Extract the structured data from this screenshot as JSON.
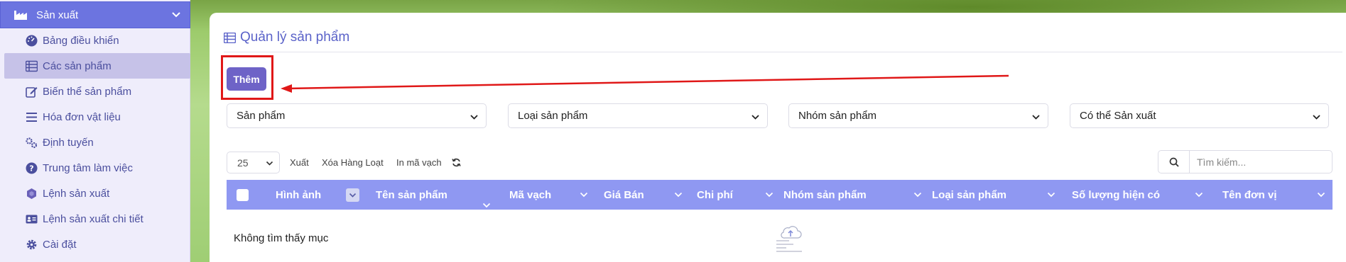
{
  "sidebar": {
    "header_label": "Sản xuất",
    "items": [
      {
        "label": "Bảng điều khiển",
        "icon": "dashboard-icon"
      },
      {
        "label": "Các sản phẩm",
        "icon": "table-list-icon",
        "active": true
      },
      {
        "label": "Biến thể sản phẩm",
        "icon": "edit-square-icon"
      },
      {
        "label": "Hóa đơn vật liệu",
        "icon": "list-lines-icon"
      },
      {
        "label": "Định tuyến",
        "icon": "gears-icon"
      },
      {
        "label": "Trung tâm làm việc",
        "icon": "question-circle-icon"
      },
      {
        "label": "Lệnh sản xuất",
        "icon": "hexagon-icon"
      },
      {
        "label": "Lệnh sản xuất chi tiết",
        "icon": "id-card-icon"
      },
      {
        "label": "Cài đặt",
        "icon": "gear-icon"
      }
    ]
  },
  "main": {
    "title": "Quản lý sản phẩm",
    "add_label": "Thêm",
    "filters": [
      "Sản phẩm",
      "Loại sản phẩm",
      "Nhóm sản phẩm",
      "Có thể Sản xuất"
    ],
    "page_size": "25",
    "toolbar": {
      "export": "Xuất",
      "bulk_delete": "Xóa Hàng Loạt",
      "print_barcode": "In mã vạch"
    },
    "search": {
      "placeholder": "Tìm kiếm..."
    },
    "columns": [
      "Hình ảnh",
      "Tên sản phẩm",
      "Mã vạch",
      "Giá Bán",
      "Chi phí",
      "Nhóm sản phẩm",
      "Loại sản phẩm",
      "Số lượng hiện có",
      "Tên đơn vị"
    ],
    "empty_text": "Không tìm thấy mục"
  },
  "colors": {
    "sidebar_header": "#6c74e0",
    "accent": "#6e63c7",
    "table_header": "#8f98f2",
    "annotation": "#e01818"
  }
}
